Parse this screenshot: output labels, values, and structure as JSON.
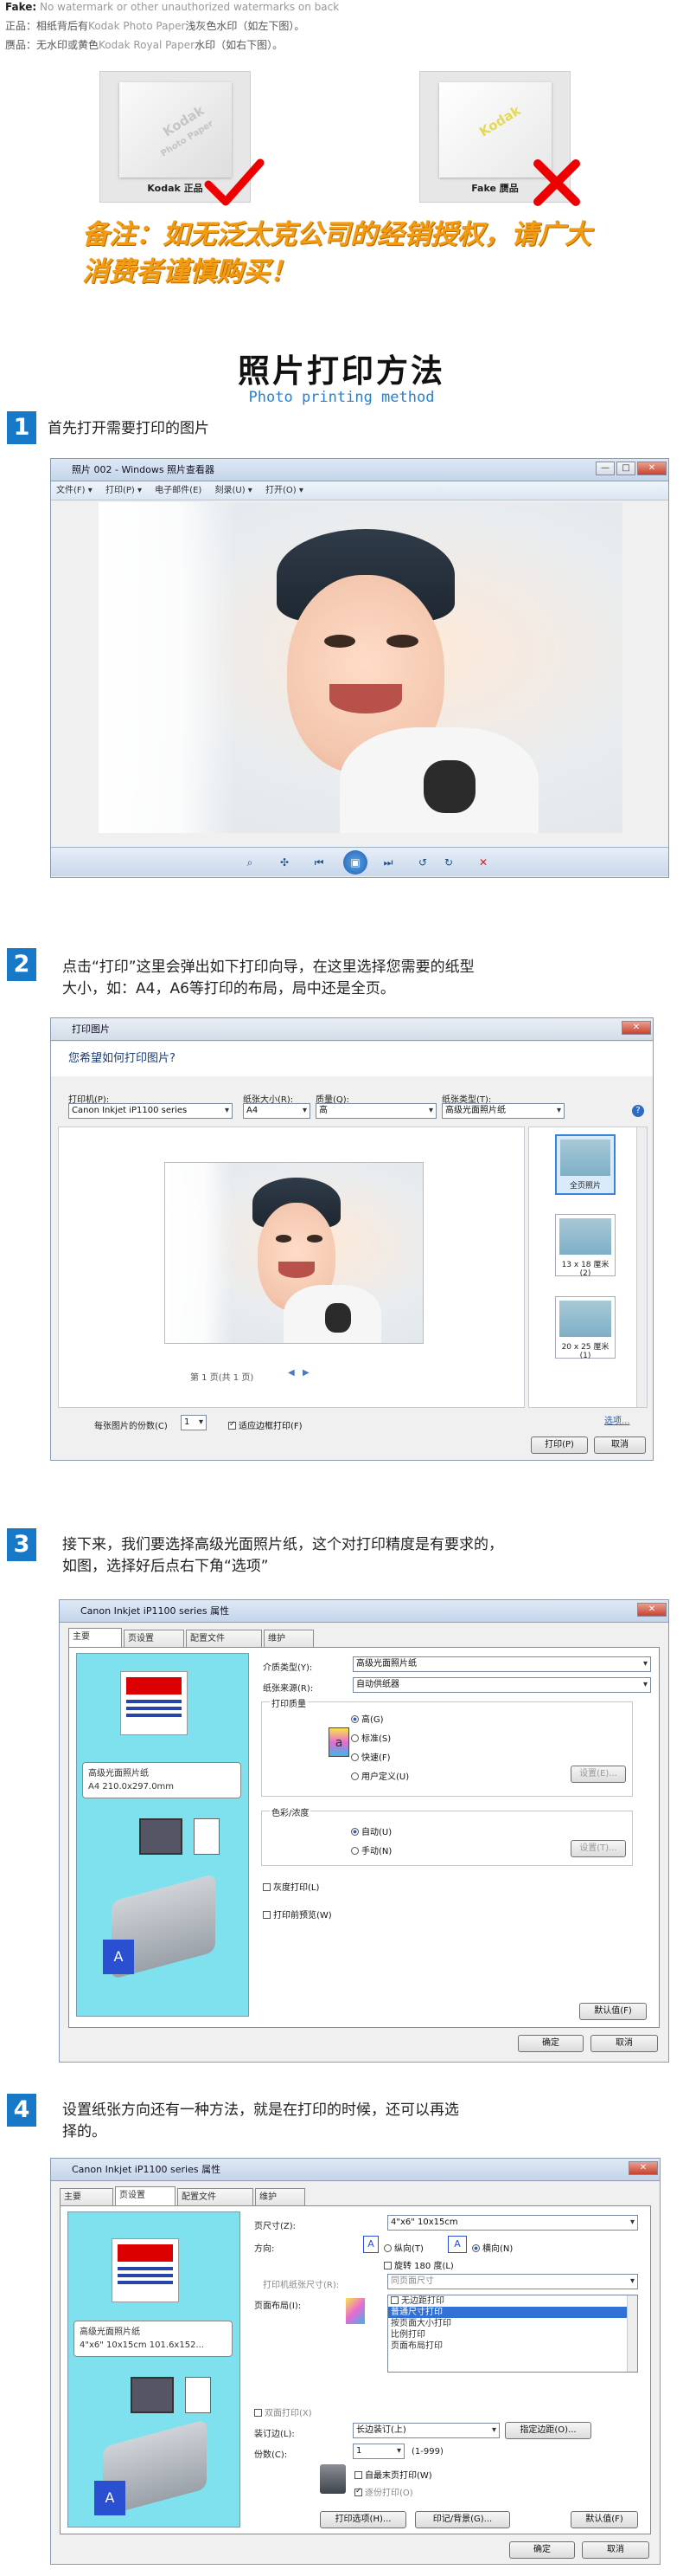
{
  "fake_note": {
    "fake_label": "Fake:",
    "fake_en": "No watermark or other unauthorized watermarks on back",
    "genuine_prefix": "正品：相纸背后有",
    "genuine_brand": "Kodak Photo Paper",
    "genuine_suffix": "浅灰色水印（如左下图）。",
    "fake_prefix": "赝品：无水印或黄色",
    "fake_brand": "Kodak Royal Paper",
    "fake_suffix": "水印（如右下图）。",
    "genuine_caption": "Kodak 正品",
    "fake_caption": "Fake 赝品",
    "watermark_1": "Kodak",
    "watermark_2": "Photo Paper",
    "warning_1": "备注：如无泛太克公司的经销授权，请广大",
    "warning_2": "消费者谨慎购买！"
  },
  "title": "照片打印方法",
  "subtitle": "Photo printing method",
  "steps": [
    {
      "num": "1",
      "text": "首先打开需要打印的图片"
    },
    {
      "num": "2",
      "text_1": "点击“打印”这里会弹出如下打印向导，在这里选择您需要的纸型",
      "text_2": "大小，如：A4，A6等打印的布局，局中还是全页。"
    },
    {
      "num": "3",
      "text_1": "接下来，我们要选择高级光面照片纸，这个对打印精度是有要求的，",
      "text_2": "如图，选择好后点右下角“选项”"
    },
    {
      "num": "4",
      "text_1": "设置纸张方向还有一种方法，就是在打印的时候，还可以再选",
      "text_2": "择的。"
    }
  ],
  "viewer": {
    "title": "照片 002 - Windows 照片查看器",
    "menus": [
      "文件(F) ▾",
      "打印(P) ▾",
      "电子邮件(E)",
      "刻录(U) ▾",
      "打开(O) ▾"
    ],
    "min": "—",
    "max": "□",
    "close": "✕"
  },
  "print_dialog": {
    "title": "打印图片",
    "question": "您希望如何打印图片?",
    "printer_label": "打印机(P):",
    "printer_value": "Canon Inkjet iP1100 series",
    "paper_label": "纸张大小(R):",
    "paper_value": "A4",
    "quality_label": "质量(Q):",
    "quality_value": "高",
    "type_label": "纸张类型(T):",
    "type_value": "高级光面照片纸",
    "page_info": "第 1 页(共 1 页)",
    "copies_label": "每张图片的份数(C)",
    "copies_value": "1",
    "fit_label": "适应边框打印(F)",
    "options_link": "选项...",
    "print_btn": "打印(P)",
    "cancel_btn": "取消",
    "layouts": [
      "全页照片",
      "13 x 18 厘米 (2)",
      "20 x 25 厘米 (1)"
    ]
  },
  "props_main": {
    "title": "Canon Inkjet iP1100 series 属性",
    "tabs": [
      "主要",
      "页设置",
      "配置文件",
      "维护"
    ],
    "media_label": "介质类型(Y):",
    "media_value": "高级光面照片纸",
    "source_label": "纸张来源(R):",
    "source_value": "自动供纸器",
    "quality_group": "打印质量",
    "q_high": "高(G)",
    "q_standard": "标准(S)",
    "q_fast": "快速(F)",
    "q_custom": "用户定义(U)",
    "settings_1": "设置(E)...",
    "color_group": "色彩/浓度",
    "c_auto": "自动(U)",
    "c_manual": "手动(N)",
    "settings_2": "设置(T)...",
    "grayscale": "灰度打印(L)",
    "preview": "打印前预览(W)",
    "paper_info_1": "高级光面照片纸",
    "paper_info_2": "A4 210.0x297.0mm",
    "defaults": "默认值(F)",
    "ok": "确定",
    "cancel": "取消"
  },
  "props_page": {
    "title": "Canon Inkjet iP1100 series 属性",
    "tabs": [
      "主要",
      "页设置",
      "配置文件",
      "维护"
    ],
    "size_label": "页尺寸(Z):",
    "size_value": "4\"x6\" 10x15cm",
    "orient_label": "方向:",
    "portrait": "纵向(T)",
    "landscape": "横向(N)",
    "rotate": "旋转 180 度(L)",
    "printer_paper_label": "打印机纸张尺寸(R):",
    "printer_paper_value": "同页面尺寸",
    "layout_label": "页面布局(I):",
    "layouts": [
      "无边距打印",
      "普通尺寸打印",
      "按页面大小打印",
      "比例打印",
      "页面布局打印"
    ],
    "paper_info_1": "高级光面照片纸",
    "paper_info_2": "4\"x6\" 10x15cm 101.6x152...",
    "duplex": "双面打印(X)",
    "binding_label": "装订边(L):",
    "binding_value": "长边装订(上)",
    "margin_btn": "指定边距(O)...",
    "copies_label": "份数(C):",
    "copies_value": "1",
    "copies_range": "(1-999)",
    "last_first": "自最末页打印(W)",
    "collate": "逐份打印(O)",
    "options_btn": "打印选项(H)...",
    "stamp_btn": "印记/背景(G)...",
    "defaults": "默认值(F)",
    "ok": "确定",
    "cancel": "取消"
  }
}
